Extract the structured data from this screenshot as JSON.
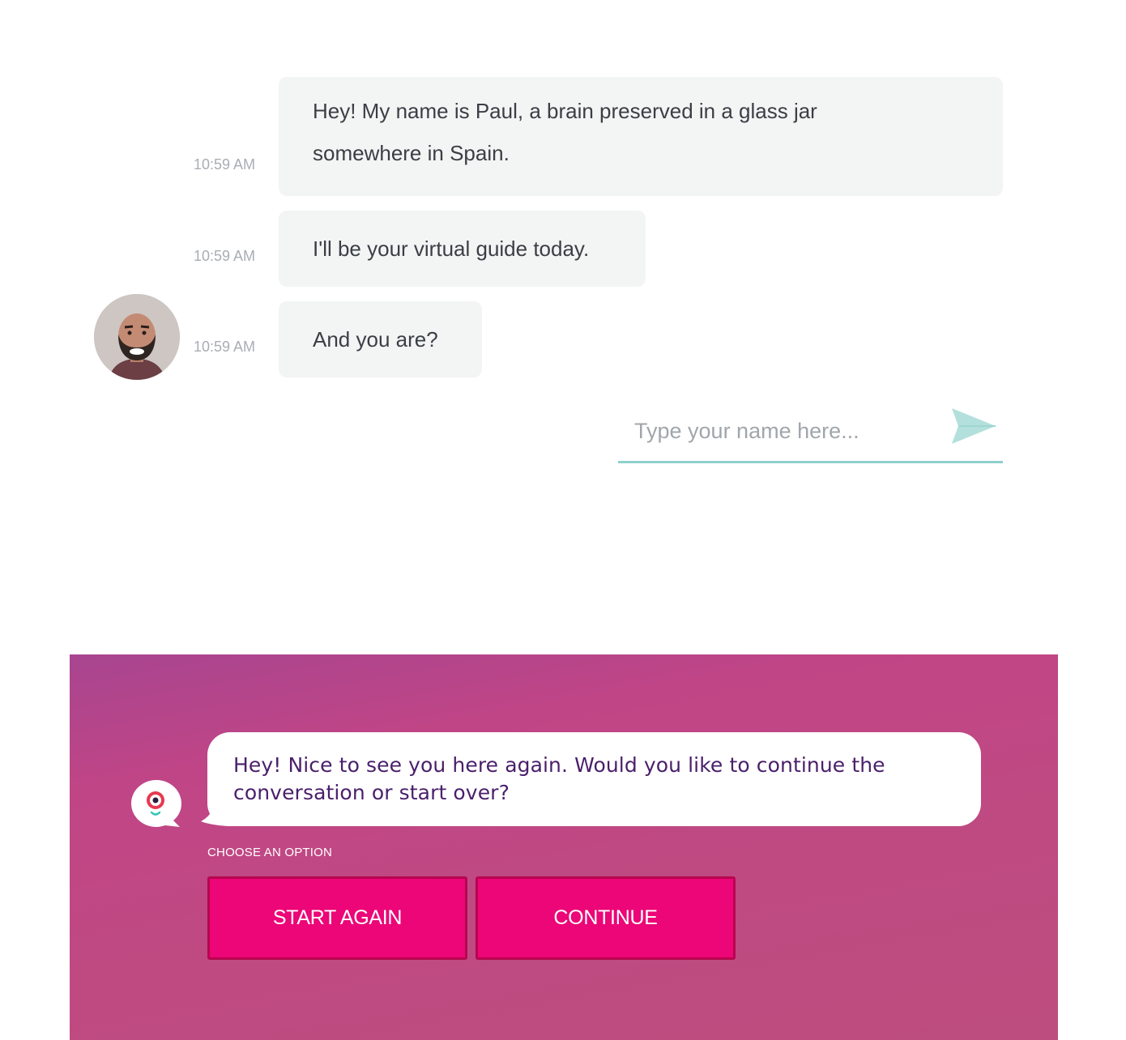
{
  "chat": {
    "messages": [
      {
        "time": "10:59 AM",
        "lines": [
          "Hey! My name is Paul, a brain preserved in a glass jar",
          "somewhere in Spain."
        ]
      },
      {
        "time": "10:59 AM",
        "text": "I'll be your virtual guide today."
      },
      {
        "time": "10:59 AM",
        "text": "And you are?"
      }
    ],
    "input": {
      "placeholder": "Type your name here...",
      "value": ""
    },
    "accent_color": "#8fd0cc"
  },
  "panel": {
    "bot_message": [
      "Hey! Nice to see you here again. Would you like to continue the",
      "conversation or start over?"
    ],
    "choose_label": "CHOOSE AN OPTION",
    "options": [
      "START AGAIN",
      "CONTINUE"
    ],
    "button_color": "#ec0677"
  }
}
